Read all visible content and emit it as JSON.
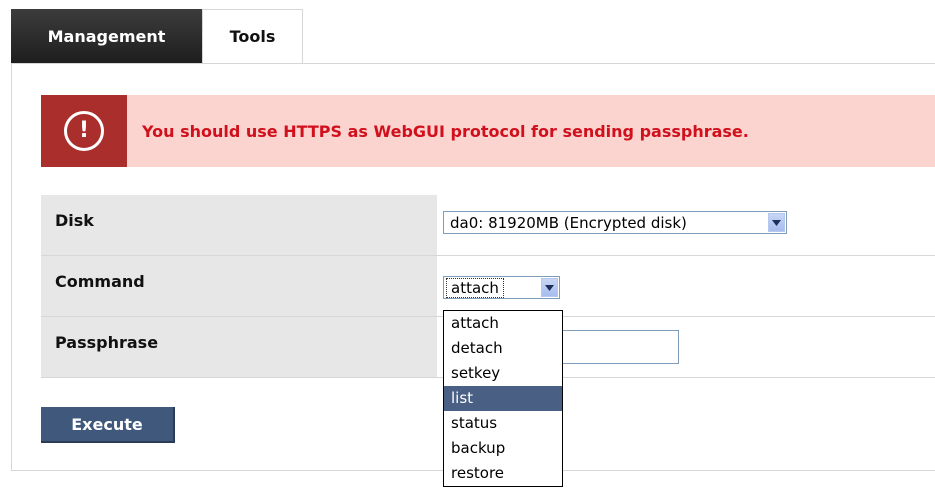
{
  "tabs": [
    {
      "label": "Management",
      "active": true
    },
    {
      "label": "Tools",
      "active": false
    }
  ],
  "warning": {
    "icon": "exclamation-circle-icon",
    "message": "You should use HTTPS as WebGUI protocol for sending passphrase."
  },
  "form": {
    "disk": {
      "label": "Disk",
      "selected": "da0: 81920MB (Encrypted disk)"
    },
    "command": {
      "label": "Command",
      "selected": "attach",
      "options": [
        "attach",
        "detach",
        "setkey",
        "list",
        "status",
        "backup",
        "restore"
      ],
      "highlighted": "list"
    },
    "passphrase": {
      "label": "Passphrase",
      "value": ""
    }
  },
  "execute_label": "Execute",
  "colors": {
    "active_tab": "#1e1e1e",
    "warning_bg": "#fcd4cf",
    "warning_icon_bg": "#aa2e2b",
    "warning_text": "#d0101c",
    "label_bg": "#e7e7e7",
    "button_bg": "#3f587c",
    "option_highlight": "#4a5f84"
  }
}
